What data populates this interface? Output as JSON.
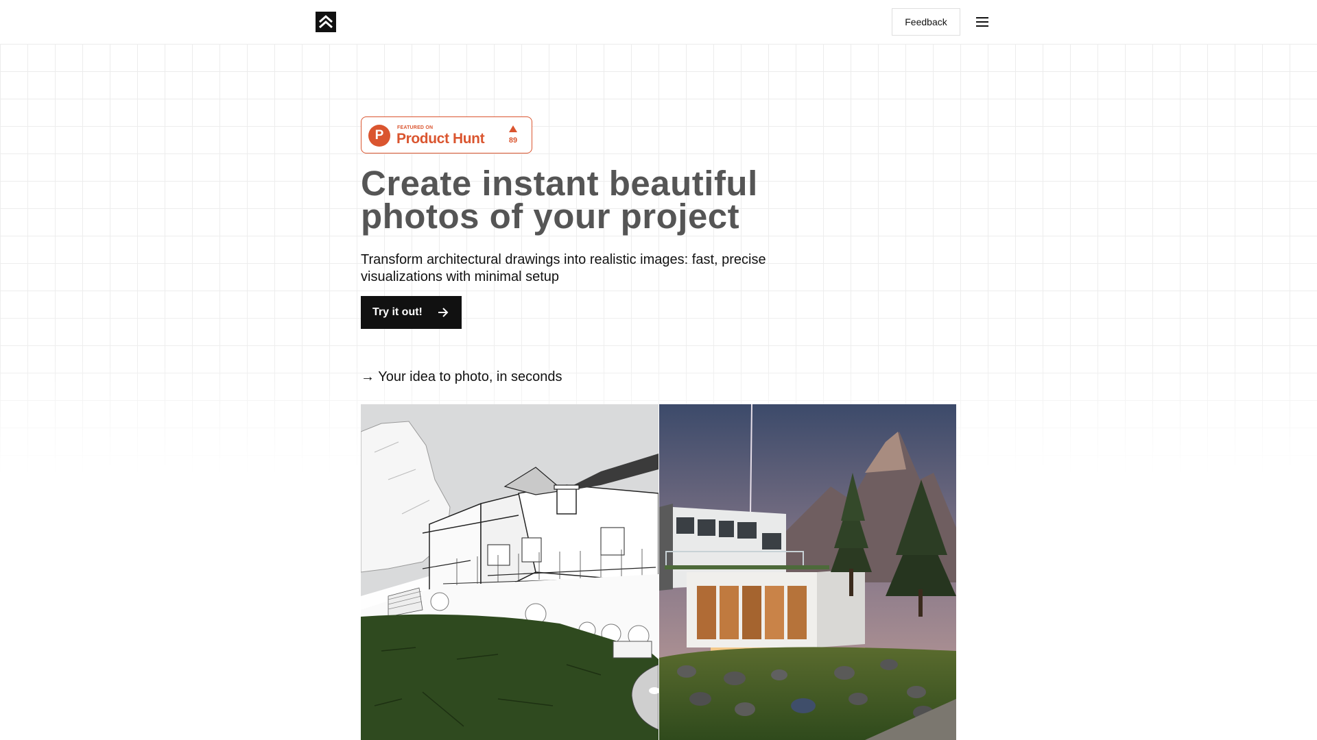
{
  "header": {
    "feedback_label": "Feedback"
  },
  "badge": {
    "featured_on": "FEATURED ON",
    "name": "Product Hunt",
    "upvotes": "89",
    "brand_color": "#da552f"
  },
  "hero": {
    "title_line1": "Create instant beautiful",
    "title_line2": "photos of your project",
    "subtitle_line1": "Transform architectural drawings into realistic images: fast, precise",
    "subtitle_line2": "visualizations with minimal setup",
    "cta_label": "Try it out!"
  },
  "showcase": {
    "tagline": "→ Your idea to photo, in seconds"
  },
  "colors": {
    "ink": "#111111",
    "title_gray": "#555555",
    "grid": "#ececec"
  },
  "icons": {
    "logo": "double-chevron-up-icon",
    "menu": "hamburger-menu-icon",
    "cta": "arrow-right-icon",
    "badge_upvote": "triangle-up-icon"
  }
}
